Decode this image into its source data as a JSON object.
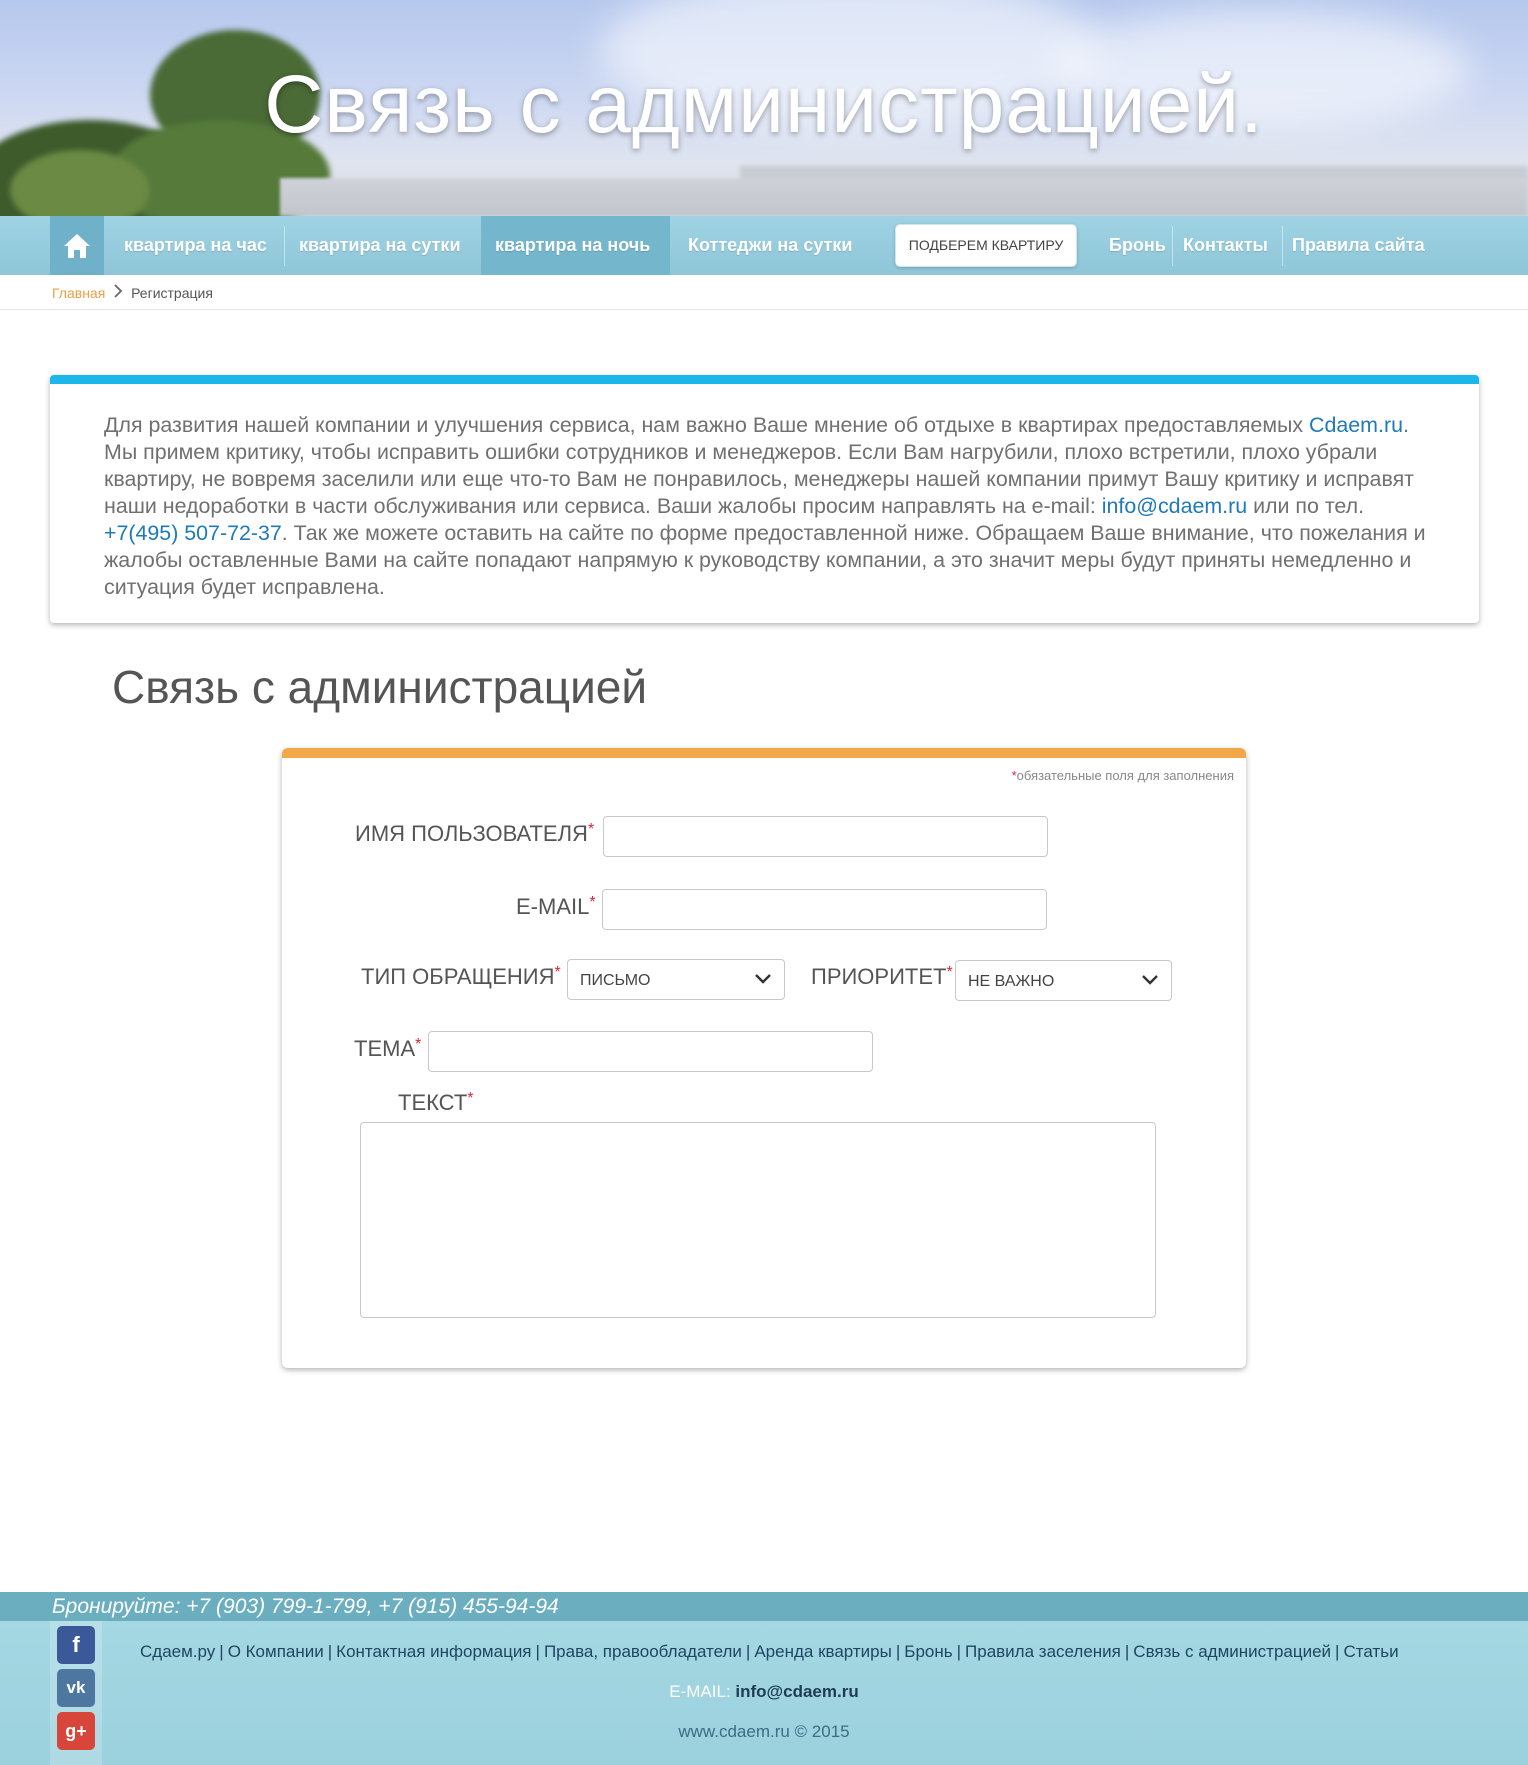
{
  "hero": {
    "title": "Связь с администрацией."
  },
  "nav": {
    "items": [
      "квартира на час",
      "квартира на сутки",
      "квартира на ночь",
      "Коттеджи на сутки"
    ],
    "pick_button": "ПОДБЕРЕМ КВАРТИРУ",
    "right_items": [
      "Бронь",
      "Контакты",
      "Правила сайта"
    ]
  },
  "breadcrumb": {
    "home": "Главная",
    "current": "Регистрация"
  },
  "info": {
    "text1": "Для развития нашей компании и улучшения сервиса, нам важно Ваше мнение об отдыхе в квартирах предоставляемых ",
    "site_link": "Cdaem.ru",
    "text2": ". Мы примем критику, чтобы исправить ошибки сотрудников и менеджеров. Если Вам нагрубили, плохо встретили, плохо убрали квартиру, не вовремя заселили или еще что-то Вам не понравилось, менеджеры нашей компании примут Вашу критику и исправят наши недоработки в части обслуживания или сервиса. Ваши жалобы просим направлять на e-mail: ",
    "email_link": "info@cdaem.ru",
    "text3": " или по тел. ",
    "phone_link": "+7(495) 507-72-37",
    "text4": ". Так же можете оставить на сайте по форме предоставленной ниже. Обращаем Ваше внимание, что пожелания и жалобы оставленные Вами на сайте попадают напрямую к руководству компании, а это значит меры будут приняты немедленно и ситуация будет исправлена."
  },
  "page_title": "Связь с администрацией",
  "form": {
    "required_note": "обязательные поля для заполнения",
    "star": "*",
    "username_label": "ИМЯ ПОЛЬЗОВАТЕЛЯ",
    "email_label": "E-MAIL",
    "type_label": "ТИП ОБРАЩЕНИЯ",
    "type_value": "ПИСЬМО",
    "priority_label": "ПРИОРИТЕТ",
    "priority_value": "НЕ ВАЖНО",
    "subject_label": "ТЕМА",
    "text_label": "ТЕКСТ"
  },
  "footer": {
    "booking": "Бронируйте: +7 (903) 799-1-799, +7 (915) 455-94-94",
    "links": [
      "Сдаем.ру",
      "О Компании",
      "Контактная информация",
      "Права, правообладатели",
      "Аренда квартиры",
      "Бронь",
      "Правила заселения",
      "Связь с администрацией",
      "Статьи"
    ],
    "email_label": "E-MAIL: ",
    "email": "info@cdaem.ru",
    "copyright": "www.cdaem.ru © 2015",
    "social": [
      "f",
      "vk",
      "g+"
    ]
  }
}
